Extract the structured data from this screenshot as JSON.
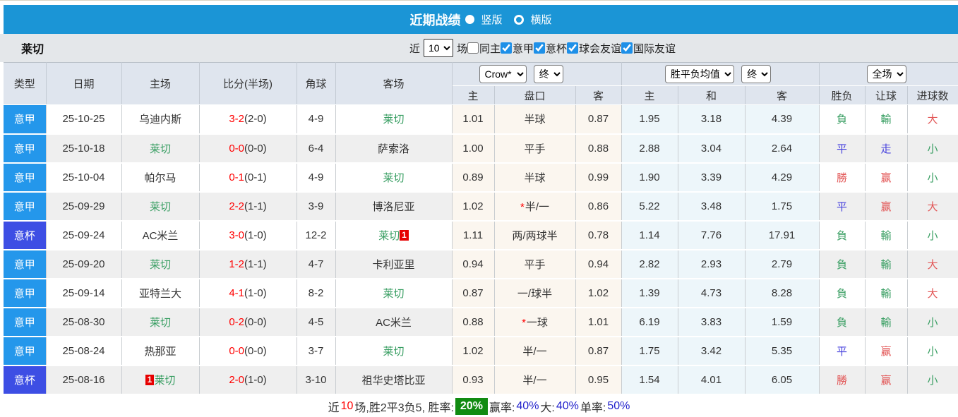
{
  "title_bar": {
    "title": "近期战绩",
    "radio_vertical": "竖版",
    "radio_horizontal": "横版"
  },
  "filter_bar": {
    "team": "莱切",
    "near_label": "近",
    "count_value": "10",
    "games_label": "场",
    "checkboxes": [
      {
        "label": "同主",
        "checked": false
      },
      {
        "label": "意甲",
        "checked": true
      },
      {
        "label": "意杯",
        "checked": true
      },
      {
        "label": "球会友谊",
        "checked": true
      },
      {
        "label": "国际友谊",
        "checked": true
      }
    ]
  },
  "table": {
    "main_headers": [
      "类型",
      "日期",
      "主场",
      "比分(半场)",
      "角球",
      "客场"
    ],
    "odds_groups": {
      "asian": {
        "selects": [
          "Crow*",
          "终"
        ],
        "subheaders": [
          "主",
          "盘口",
          "客"
        ]
      },
      "european": {
        "selects": [
          "胜平负均值",
          "终"
        ],
        "subheaders": [
          "主",
          "和",
          "客"
        ]
      },
      "fullmatch": {
        "selects": [
          "全场"
        ],
        "subheaders": [
          "胜负",
          "让球",
          "进球数"
        ]
      }
    },
    "rows": [
      {
        "league": "意甲",
        "date": "25-10-25",
        "home": {
          "name": "乌迪内斯",
          "focus": false
        },
        "score": {
          "full": "3-2",
          "half": "(2-0)"
        },
        "corners": "4-9",
        "away": {
          "name": "莱切",
          "focus": true
        },
        "asian": {
          "home": "1.01",
          "line": "半球",
          "star": false,
          "away": "0.87"
        },
        "euro": {
          "home": "1.95",
          "draw": "3.18",
          "away": "4.39"
        },
        "result": {
          "wdl": "負",
          "wdl_color": "green",
          "handicap": "輸",
          "handicap_color": "green",
          "goals": "大",
          "goals_color": "red"
        }
      },
      {
        "league": "意甲",
        "date": "25-10-18",
        "home": {
          "name": "莱切",
          "focus": true
        },
        "score": {
          "full": "0-0",
          "half": "(0-0)"
        },
        "corners": "6-4",
        "away": {
          "name": "萨索洛",
          "focus": false
        },
        "asian": {
          "home": "1.00",
          "line": "平手",
          "star": false,
          "away": "0.88"
        },
        "euro": {
          "home": "2.88",
          "draw": "3.04",
          "away": "2.64"
        },
        "result": {
          "wdl": "平",
          "wdl_color": "blue",
          "handicap": "走",
          "handicap_color": "blue",
          "goals": "小",
          "goals_color": "green"
        }
      },
      {
        "league": "意甲",
        "date": "25-10-04",
        "home": {
          "name": "帕尔马",
          "focus": false
        },
        "score": {
          "full": "0-1",
          "half": "(0-1)"
        },
        "corners": "4-9",
        "away": {
          "name": "莱切",
          "focus": true
        },
        "asian": {
          "home": "0.89",
          "line": "半球",
          "star": false,
          "away": "0.99"
        },
        "euro": {
          "home": "1.90",
          "draw": "3.39",
          "away": "4.29"
        },
        "result": {
          "wdl": "勝",
          "wdl_color": "red",
          "handicap": "赢",
          "handicap_color": "red",
          "goals": "小",
          "goals_color": "green"
        }
      },
      {
        "league": "意甲",
        "date": "25-09-29",
        "home": {
          "name": "莱切",
          "focus": true
        },
        "score": {
          "full": "2-2",
          "half": "(1-1)"
        },
        "corners": "3-9",
        "away": {
          "name": "博洛尼亚",
          "focus": false
        },
        "asian": {
          "home": "1.02",
          "line": "半/一",
          "star": true,
          "away": "0.86"
        },
        "euro": {
          "home": "5.22",
          "draw": "3.48",
          "away": "1.75"
        },
        "result": {
          "wdl": "平",
          "wdl_color": "blue",
          "handicap": "赢",
          "handicap_color": "red",
          "goals": "大",
          "goals_color": "red"
        }
      },
      {
        "league": "意杯",
        "date": "25-09-24",
        "home": {
          "name": "AC米兰",
          "focus": false
        },
        "score": {
          "full": "3-0",
          "half": "(1-0)"
        },
        "corners": "12-2",
        "away": {
          "name": "莱切",
          "focus": true,
          "badge": "1",
          "badge_pos": "after"
        },
        "asian": {
          "home": "1.11",
          "line": "两/两球半",
          "star": false,
          "away": "0.78"
        },
        "euro": {
          "home": "1.14",
          "draw": "7.76",
          "away": "17.91"
        },
        "result": {
          "wdl": "負",
          "wdl_color": "green",
          "handicap": "輸",
          "handicap_color": "green",
          "goals": "小",
          "goals_color": "green"
        }
      },
      {
        "league": "意甲",
        "date": "25-09-20",
        "home": {
          "name": "莱切",
          "focus": true
        },
        "score": {
          "full": "1-2",
          "half": "(1-1)"
        },
        "corners": "4-7",
        "away": {
          "name": "卡利亚里",
          "focus": false
        },
        "asian": {
          "home": "0.94",
          "line": "平手",
          "star": false,
          "away": "0.94"
        },
        "euro": {
          "home": "2.82",
          "draw": "2.93",
          "away": "2.79"
        },
        "result": {
          "wdl": "負",
          "wdl_color": "green",
          "handicap": "輸",
          "handicap_color": "green",
          "goals": "大",
          "goals_color": "red"
        }
      },
      {
        "league": "意甲",
        "date": "25-09-14",
        "home": {
          "name": "亚特兰大",
          "focus": false
        },
        "score": {
          "full": "4-1",
          "half": "(1-0)"
        },
        "corners": "8-2",
        "away": {
          "name": "莱切",
          "focus": true
        },
        "asian": {
          "home": "0.87",
          "line": "一/球半",
          "star": false,
          "away": "1.02"
        },
        "euro": {
          "home": "1.39",
          "draw": "4.73",
          "away": "8.28"
        },
        "result": {
          "wdl": "負",
          "wdl_color": "green",
          "handicap": "輸",
          "handicap_color": "green",
          "goals": "大",
          "goals_color": "red"
        }
      },
      {
        "league": "意甲",
        "date": "25-08-30",
        "home": {
          "name": "莱切",
          "focus": true
        },
        "score": {
          "full": "0-2",
          "half": "(0-0)"
        },
        "corners": "4-5",
        "away": {
          "name": "AC米兰",
          "focus": false
        },
        "asian": {
          "home": "0.88",
          "line": "一球",
          "star": true,
          "away": "1.01"
        },
        "euro": {
          "home": "6.19",
          "draw": "3.83",
          "away": "1.59"
        },
        "result": {
          "wdl": "負",
          "wdl_color": "green",
          "handicap": "輸",
          "handicap_color": "green",
          "goals": "小",
          "goals_color": "green"
        }
      },
      {
        "league": "意甲",
        "date": "25-08-24",
        "home": {
          "name": "热那亚",
          "focus": false
        },
        "score": {
          "full": "0-0",
          "half": "(0-0)"
        },
        "corners": "3-7",
        "away": {
          "name": "莱切",
          "focus": true
        },
        "asian": {
          "home": "1.02",
          "line": "半/一",
          "star": false,
          "away": "0.87"
        },
        "euro": {
          "home": "1.75",
          "draw": "3.42",
          "away": "5.35"
        },
        "result": {
          "wdl": "平",
          "wdl_color": "blue",
          "handicap": "赢",
          "handicap_color": "red",
          "goals": "小",
          "goals_color": "green"
        }
      },
      {
        "league": "意杯",
        "date": "25-08-16",
        "home": {
          "name": "莱切",
          "focus": true,
          "badge": "1",
          "badge_pos": "before"
        },
        "score": {
          "full": "2-0",
          "half": "(1-0)"
        },
        "corners": "3-10",
        "away": {
          "name": "祖华史塔比亚",
          "focus": false
        },
        "asian": {
          "home": "0.93",
          "line": "半/一",
          "star": false,
          "away": "0.95"
        },
        "euro": {
          "home": "1.54",
          "draw": "4.01",
          "away": "6.05"
        },
        "result": {
          "wdl": "勝",
          "wdl_color": "red",
          "handicap": "赢",
          "handicap_color": "red",
          "goals": "小",
          "goals_color": "green"
        }
      }
    ]
  },
  "summary": {
    "segments": [
      {
        "text": "近",
        "style": "dark"
      },
      {
        "text": "10",
        "style": "red"
      },
      {
        "text": "场,胜2平3负5, 胜率:",
        "style": "dark"
      },
      {
        "text": "20%",
        "style": "badge-green"
      },
      {
        "text": "赢率:",
        "style": "dark"
      },
      {
        "text": "40%",
        "style": "blue"
      },
      {
        "text": " 大:",
        "style": "dark"
      },
      {
        "text": "40%",
        "style": "blue"
      },
      {
        "text": " 单率:",
        "style": "dark"
      },
      {
        "text": "50%",
        "style": "blue"
      }
    ]
  },
  "colors": {
    "titlebar_blue": "#1b95d6",
    "serie_a_badge": "#2497eb",
    "coppa_badge": "#3d4ee4",
    "focus_team_green": "#389e62",
    "win_red": "#e25555",
    "draw_blue": "#4640dd",
    "score_red": "#ff0000",
    "redcard_badge": "#e60000",
    "summary_badge_green": "#118b11",
    "summary_value_blue": "#2222cc",
    "asian_col_bg": "#fbf6ef",
    "euro_col_bg": "#edf6fa"
  }
}
